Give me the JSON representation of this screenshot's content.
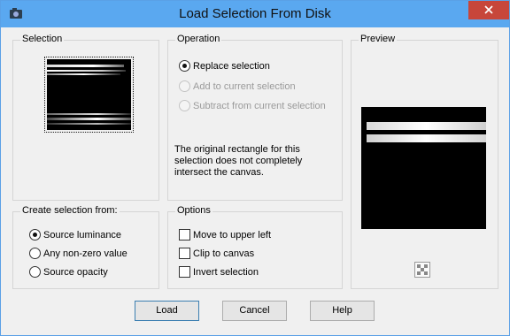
{
  "window": {
    "title": "Load Selection From Disk",
    "close_glyph": "✕"
  },
  "groups": {
    "selection": "Selection",
    "operation": "Operation",
    "preview": "Preview",
    "create_from": "Create selection from:",
    "options": "Options"
  },
  "operation": {
    "items": [
      {
        "label": "Replace selection",
        "checked": true,
        "enabled": true
      },
      {
        "label": "Add to current selection",
        "checked": false,
        "enabled": false
      },
      {
        "label": "Subtract from current selection",
        "checked": false,
        "enabled": false
      }
    ],
    "note": "The original rectangle for this selection does not completely intersect the canvas."
  },
  "create_from": {
    "items": [
      {
        "label": "Source luminance",
        "checked": true
      },
      {
        "label": "Any non-zero value",
        "checked": false
      },
      {
        "label": "Source opacity",
        "checked": false
      }
    ]
  },
  "options": {
    "items": [
      {
        "label": "Move to upper left",
        "checked": false
      },
      {
        "label": "Clip to canvas",
        "checked": false
      },
      {
        "label": "Invert selection",
        "checked": false
      }
    ]
  },
  "buttons": {
    "load": "Load",
    "cancel": "Cancel",
    "help": "Help"
  },
  "icons": {
    "app": "camera-icon",
    "close": "close-icon",
    "zoom": "checker-zoom-icon"
  },
  "colors": {
    "titlebar": "#5aa8f0",
    "close": "#c7463a",
    "default_button_border": "#3c7fb1"
  }
}
